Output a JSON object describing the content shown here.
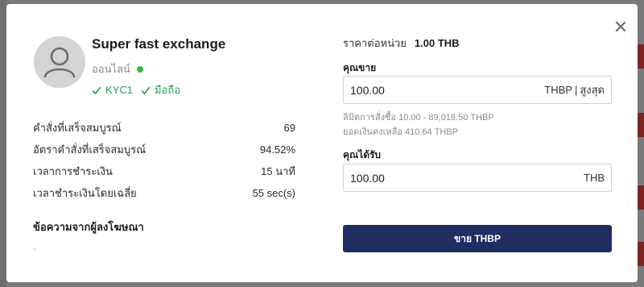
{
  "seller": {
    "name": "Super fast exchange",
    "status": "ออนไลน์",
    "badges": [
      "KYC1",
      "มือถือ"
    ]
  },
  "stats": [
    {
      "label": "คำสั่งที่เสร็จสมบูรณ์",
      "value": "69"
    },
    {
      "label": "อัตราคำสั่งที่เสร็จสมบูรณ์",
      "value": "94.52%"
    },
    {
      "label": "เวลาการชำระเงิน",
      "value": "15 นาที"
    },
    {
      "label": "เวลาชำระเงินโดยเฉลี่ย",
      "value": "55 sec(s)"
    }
  ],
  "ad_message": {
    "heading": "ข้อความจากผู้ลงโฆษณา",
    "body": "-"
  },
  "trade": {
    "unit_price_label": "ราคาต่อหน่วย",
    "unit_price_value": "1.00 THB",
    "sell_label": "คุณขาย",
    "sell_value": "100.00",
    "sell_currency": "THBP",
    "sell_separator": "|",
    "sell_max": "สูงสุด",
    "limit_text": "ลิมิตการสั่งซื้อ 10.00 - 89,018.50 THBP",
    "balance_text": "ยอดเงินคงเหลือ 410.64 THBP",
    "receive_label": "คุณได้รับ",
    "receive_value": "100.00",
    "receive_currency": "THB",
    "submit_label": "ขาย THBP"
  },
  "colors": {
    "primary_button": "#1f2d63",
    "online": "#3bb54a",
    "verified": "#2e9e55"
  }
}
